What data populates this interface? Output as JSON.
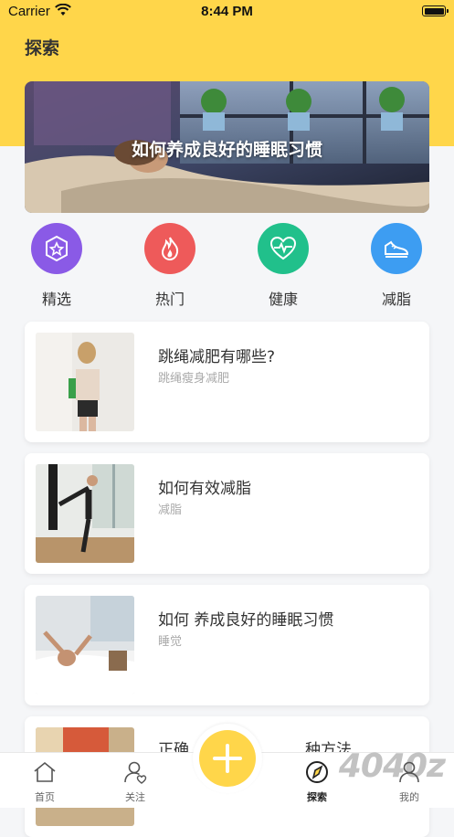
{
  "status_bar": {
    "carrier": "Carrier",
    "time": "8:44 PM"
  },
  "header": {
    "title": "探索"
  },
  "banner": {
    "title": "如何养成良好的睡眠习惯"
  },
  "categories": [
    {
      "label": "精选",
      "icon": "star-badge-icon",
      "color": "#8a5ae6"
    },
    {
      "label": "热门",
      "icon": "fire-icon",
      "color": "#ee5a5a"
    },
    {
      "label": "健康",
      "icon": "heart-pulse-icon",
      "color": "#21c08b"
    },
    {
      "label": "减脂",
      "icon": "sneaker-icon",
      "color": "#3d9df2"
    }
  ],
  "articles": [
    {
      "title": "跳绳减肥有哪些?",
      "subtitle": "跳绳瘦身减肥"
    },
    {
      "title": "如何有效减脂",
      "subtitle": "减脂"
    },
    {
      "title": "如何 养成良好的睡眠习惯",
      "subtitle": "睡觉"
    },
    {
      "title": "正确",
      "title_end": "种方法"
    }
  ],
  "tabbar": {
    "items": [
      {
        "label": "首页",
        "icon": "home-icon"
      },
      {
        "label": "关注",
        "icon": "user-heart-icon"
      },
      {
        "label": "探索",
        "icon": "compass-icon",
        "active": true
      },
      {
        "label": "我的",
        "icon": "profile-icon"
      }
    ],
    "fab_icon": "plus-icon"
  },
  "watermark": "4040z"
}
